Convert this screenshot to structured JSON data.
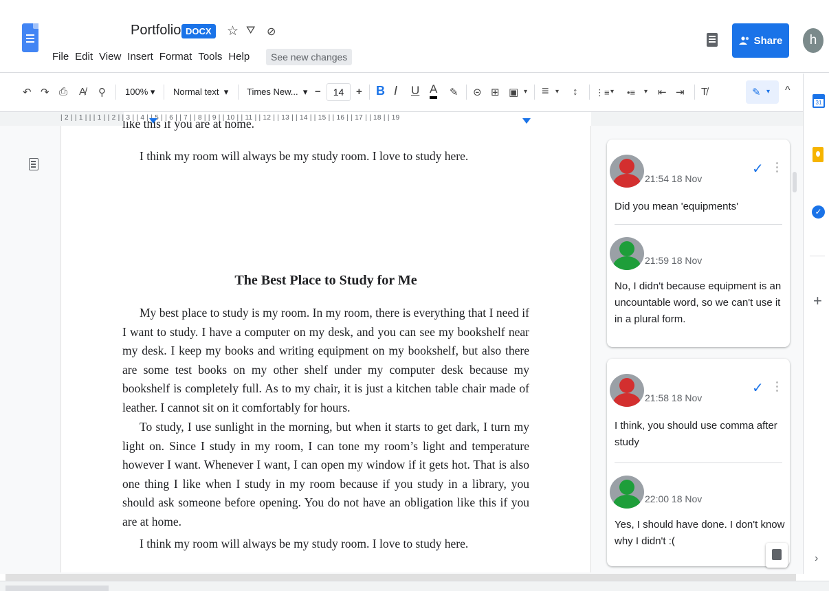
{
  "header": {
    "title": "Portfolio",
    "badge": "DOCX",
    "star": "☆",
    "drive": "⛛",
    "saved": "⊘",
    "menu": [
      "File",
      "Edit",
      "View",
      "Insert",
      "Format",
      "Tools",
      "Help"
    ],
    "see_changes": "See new changes",
    "share_label": "Share",
    "account_initial": "h"
  },
  "toolbar": {
    "undo": "↶",
    "redo": "↷",
    "print": "⎙",
    "spell": "A̸",
    "paint": "⚲",
    "zoom": "100%",
    "style": "Normal text",
    "font": "Times New...",
    "minus": "−",
    "font_size": "14",
    "plus": "+",
    "bold": "B",
    "italic": "I",
    "underline": "U",
    "text_color": "A",
    "highlight": "✎",
    "link": "⊝",
    "comment": "⊞",
    "image": "▣",
    "align": "≡",
    "line_spacing": "↕",
    "checklist": "⋮≡",
    "bullets": "•≡",
    "numbered": "1≡",
    "indent_less": "⇤",
    "indent_more": "⇥",
    "clear_format": "T̸",
    "editing_mode": "✎",
    "collapse": "^"
  },
  "ruler": {
    "text": "| 2 |   | 1 |   |   | 1 |   | 2 |   | 3 |   | 4 |   | 5 |   | 6 |   | 7 |   | 8 |   | 9 |   | 10 |   | 11 |   | 12 |   | 13 |   | 14 |   | 15 |   | 16 |   | 17 |   | 18 |   | 19"
  },
  "document": {
    "cut_line": "like this if you are at home.",
    "p_top": "I think my room will always be my study room. I love to study here.",
    "title": "The Best Place to Study for Me",
    "p1": "My best place to study is my room. In my room, there is everything that I need if I want to study. I have a computer on my desk, and you can see my bookshelf near my desk. I keep my books and writing equipment on my bookshelf, but also there are some test books on my other shelf under my computer desk because my bookshelf is completely full. As to my chair, it is just a kitchen table chair made of leather. I cannot sit on it comfortably for hours.",
    "p2": "To study, I use sunlight in the morning, but when it starts to get dark, I turn my light on. Since I study in my room, I can tone my room’s light and temperature however I want. Whenever I want, I can open my window if it gets hot. That is also one thing I like when I study in my room because if you study in a library, you should ask someone before opening. You do not have an obligation like this if you are at home.",
    "p3": "I think my room will always be my study room. I love to study here."
  },
  "comments": [
    {
      "resolve": "✓",
      "entries": [
        {
          "avatar": "red",
          "time": "21:54 18 Nov",
          "text": "Did you mean 'equipments'"
        },
        {
          "avatar": "green",
          "time": "21:59 18 Nov",
          "text": "No, I didn't because equipment is an uncountable word, so we can't use it in a plural form."
        }
      ]
    },
    {
      "resolve": "✓",
      "entries": [
        {
          "avatar": "red",
          "time": "21:58 18 Nov",
          "text": "I think, you should use comma after study"
        },
        {
          "avatar": "green",
          "time": "22:00 18 Nov",
          "text": "Yes, I should have done. I don't know why I didn't :("
        }
      ]
    }
  ],
  "sidepanel": {
    "calendar_day": "31",
    "tasks": "✓",
    "add": "+",
    "expand": "›"
  }
}
